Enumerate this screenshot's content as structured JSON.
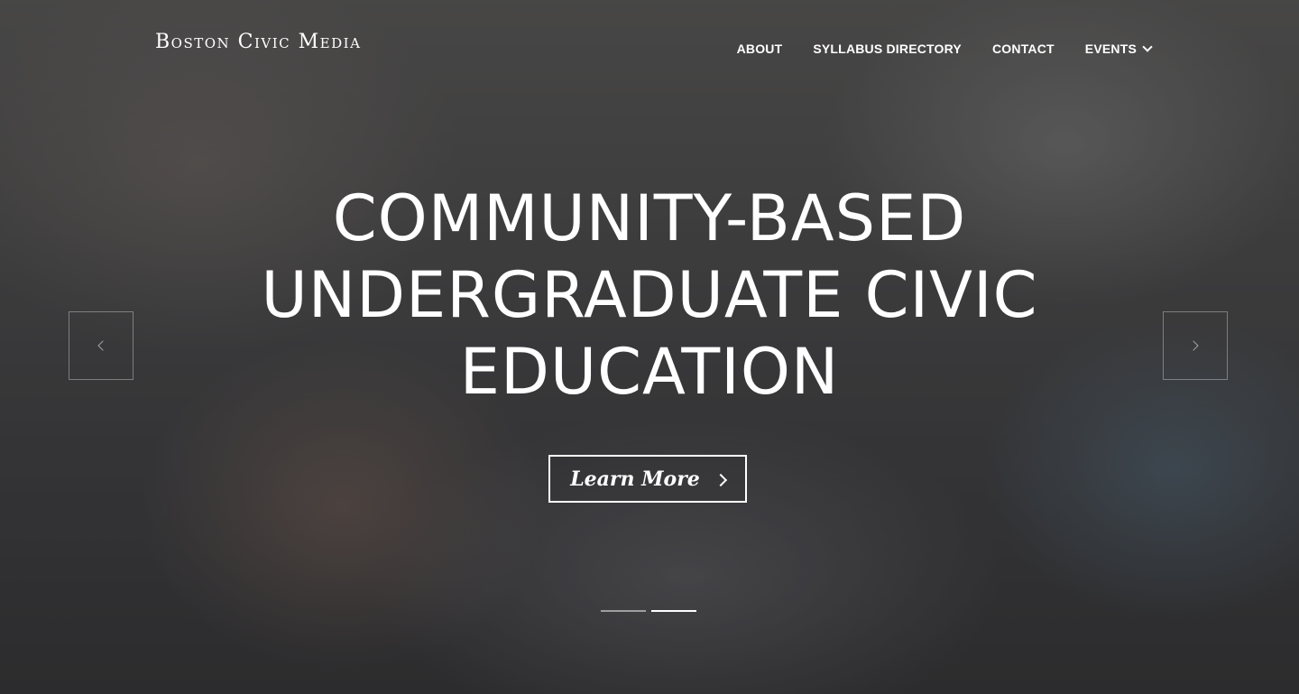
{
  "site": {
    "logo": "Boston Civic Media"
  },
  "nav": {
    "items": [
      {
        "label": "ABOUT"
      },
      {
        "label": "SYLLABUS DIRECTORY"
      },
      {
        "label": "CONTACT"
      },
      {
        "label": "EVENTS",
        "has_dropdown": true
      }
    ]
  },
  "hero": {
    "headline_lines": [
      "COMMUNITY-BASED",
      "UNDERGRADUATE CIVIC",
      "EDUCATION"
    ],
    "cta_label": "Learn More",
    "cta_icon": "chevron-right-icon",
    "prev_icon": "chevron-left-icon",
    "next_icon": "chevron-right-icon",
    "slides": {
      "count": 2,
      "active_index": 1
    }
  },
  "colors": {
    "text": "#ffffff",
    "overlay": "#2b2b2b"
  }
}
